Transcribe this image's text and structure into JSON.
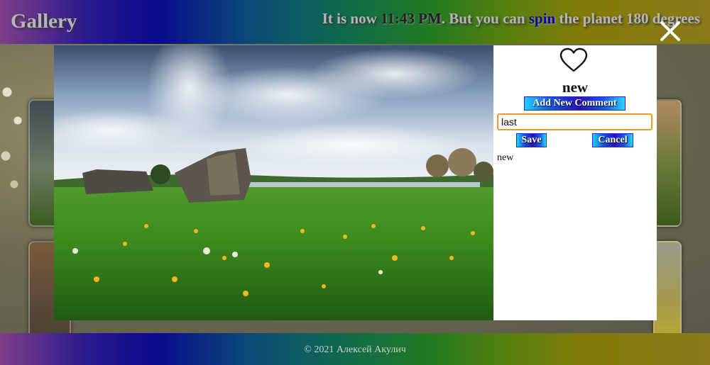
{
  "header": {
    "brand": "Gallery",
    "time_prefix": "It is now ",
    "time": "11:43 PM",
    "time_mid": ". But you can ",
    "spin_label": "spin",
    "time_suffix": " the planet 180 degrees"
  },
  "modal": {
    "close_icon": "close-icon",
    "like_icon": "heart-icon",
    "photo_title": "new",
    "add_comment_label": "Add New Comment",
    "comment_input_value": "last",
    "save_label": "Save",
    "cancel_label": "Cancel",
    "comments": [
      "new"
    ]
  },
  "footer": {
    "copyright": "© 2021 Алексей Акулич"
  },
  "colors": {
    "button_gradient_start": "#1fd1ff",
    "button_gradient_mid": "#2a12b8",
    "input_border": "#e79c2c",
    "spin_link": "#0a0a8a"
  }
}
